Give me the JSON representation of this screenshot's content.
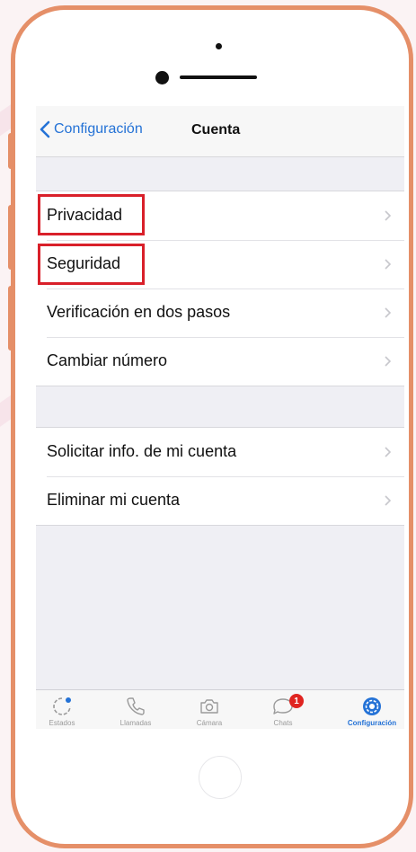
{
  "navbar": {
    "back_label": "Configuración",
    "title": "Cuenta"
  },
  "group1": [
    {
      "label": "Privacidad",
      "highlighted": true
    },
    {
      "label": "Seguridad",
      "highlighted": true
    },
    {
      "label": "Verificación en dos pasos",
      "highlighted": false
    },
    {
      "label": "Cambiar número",
      "highlighted": false
    }
  ],
  "group2": [
    {
      "label": "Solicitar info. de mi cuenta"
    },
    {
      "label": "Eliminar mi cuenta"
    }
  ],
  "tabbar": [
    {
      "label": "Estados",
      "icon": "status-icon",
      "active": false
    },
    {
      "label": "Llamadas",
      "icon": "phone-icon",
      "active": false
    },
    {
      "label": "Cámara",
      "icon": "camera-icon",
      "active": false
    },
    {
      "label": "Chats",
      "icon": "chat-icon",
      "active": false,
      "badge": "1"
    },
    {
      "label": "Configuración",
      "icon": "settings-icon",
      "active": true
    }
  ],
  "colors": {
    "accent": "#2472d6",
    "highlight_box": "#d9202a",
    "phone_frame": "#e58f68",
    "badge": "#e02420"
  }
}
